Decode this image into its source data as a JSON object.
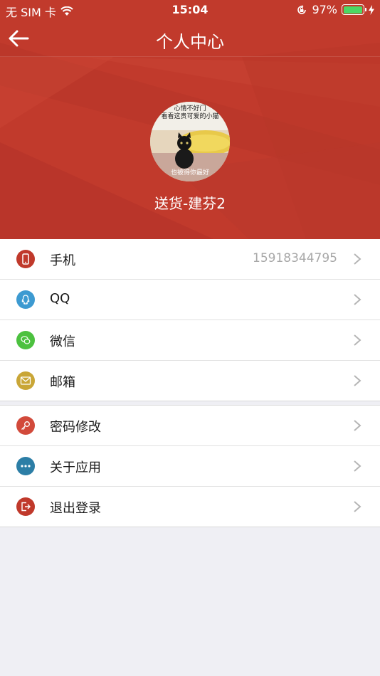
{
  "status": {
    "carrier": "无 SIM 卡",
    "time": "15:04",
    "battery": "97%",
    "battery_level": 97
  },
  "nav": {
    "title": "个人中心"
  },
  "profile": {
    "name": "送货-建芬2",
    "avatar_caption_top": "心情不好门",
    "avatar_caption_mid": "看看这贵可爱的小猫",
    "avatar_caption_bottom": "也被得你最好"
  },
  "contact": [
    {
      "label": "手机",
      "value": "15918344795",
      "icon": "phone-icon",
      "color": "#c0392b"
    },
    {
      "label": "QQ",
      "value": "",
      "icon": "qq-icon",
      "color": "#3d9ad1"
    },
    {
      "label": "微信",
      "value": "",
      "icon": "wechat-icon",
      "color": "#4cc13f"
    },
    {
      "label": "邮箱",
      "value": "",
      "icon": "mail-icon",
      "color": "#c9a637"
    }
  ],
  "settings": [
    {
      "label": "密码修改",
      "icon": "key-icon",
      "color": "#d24a3b"
    },
    {
      "label": "关于应用",
      "icon": "more-icon",
      "color": "#2c7ea6"
    },
    {
      "label": "退出登录",
      "icon": "logout-icon",
      "color": "#c0392b"
    }
  ]
}
